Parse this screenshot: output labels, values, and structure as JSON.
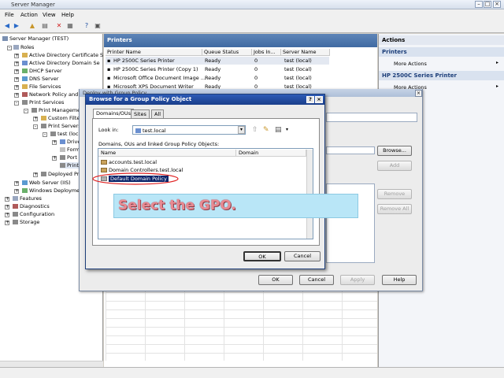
{
  "window": {
    "title": "Server Manager"
  },
  "menu": [
    "File",
    "Action",
    "View",
    "Help"
  ],
  "tree": {
    "root": "Server Manager (TEST)",
    "nodes": [
      "Roles",
      "Active Directory Certificate S",
      "Active Directory Domain Se",
      "DHCP Server",
      "DNS Server",
      "File Services",
      "Network Policy and A",
      "Print Services",
      "Print Managemen",
      "Custom Filte",
      "Print Servers",
      "test (loca",
      "Drive",
      "Form",
      "Port",
      "Print",
      "Deployed Pri",
      "Web Server (IIS)",
      "Windows Deploymen",
      "Features",
      "Diagnostics",
      "Configuration",
      "Storage"
    ]
  },
  "printers": {
    "title": "Printers",
    "columns": [
      "Printer Name",
      "Queue Status",
      "Jobs In...",
      "Server Name"
    ],
    "rows": [
      [
        "HP 2500C Series Printer",
        "Ready",
        "0",
        "test (local)"
      ],
      [
        "HP 2500C Series Printer (Copy 1)",
        "Ready",
        "0",
        "test (local)"
      ],
      [
        "Microsoft Office Document Image ...",
        "Ready",
        "0",
        "test (local)"
      ],
      [
        "Microsoft XPS Document Writer",
        "Ready",
        "0",
        "test (local)"
      ]
    ]
  },
  "actions": {
    "title": "Actions",
    "sections": [
      {
        "title": "Printers",
        "item": "More Actions"
      },
      {
        "title": "HP 2500C Series Printer",
        "item": "More Actions"
      }
    ]
  },
  "deploy_dialog": {
    "title": "Deploy with Group Policy",
    "buttons": {
      "browse": "Browse...",
      "add": "Add",
      "remove": "Remove",
      "remove_all": "Remove All",
      "ok": "OK",
      "cancel": "Cancel",
      "apply": "Apply",
      "help": "Help"
    }
  },
  "browse_dialog": {
    "title": "Browse for a Group Policy Object",
    "tabs": [
      "Domains/OUs",
      "Sites",
      "All"
    ],
    "look_in_label": "Look in:",
    "look_in_value": "test.local",
    "description": "Domains, OUs and linked Group Policy Objects:",
    "columns": [
      "Name",
      "Domain"
    ],
    "items": [
      "accounts.test.local",
      "Domain Controllers.test.local",
      "Default Domain Policy"
    ],
    "ok": "OK",
    "cancel": "Cancel"
  },
  "callout": {
    "text": "Select the GPO."
  },
  "colors": {
    "dialog_title": "#1a3e8a",
    "selection": "#0a246a",
    "callout_bg": "#b9e6f7",
    "highlight_ellipse": "#e02020"
  }
}
